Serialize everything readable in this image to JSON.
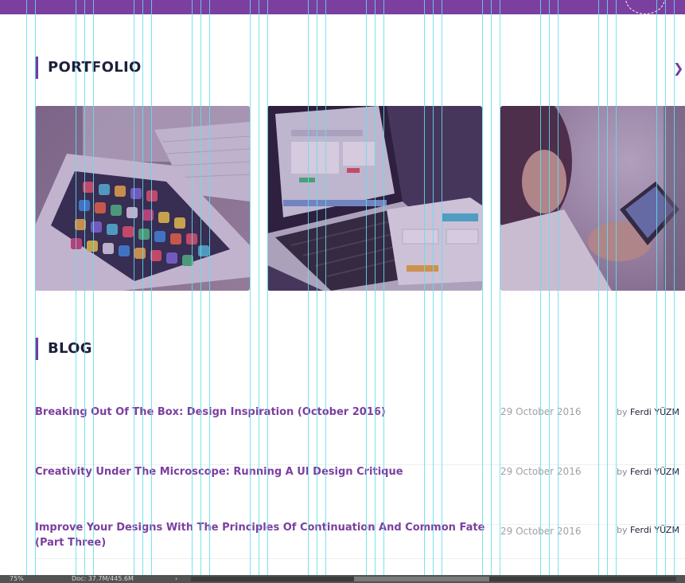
{
  "portfolio": {
    "title": "PORTFOLIO",
    "next_arrow": "❯",
    "items": [
      {
        "icon": "tablet-photo"
      },
      {
        "icon": "laptop-photo"
      },
      {
        "icon": "phone-photo"
      }
    ]
  },
  "blog": {
    "title": "BLOG",
    "by_label": "by",
    "posts": [
      {
        "title": "Breaking Out Of The Box: Design Inspiration (October 2016)",
        "date": "29 October 2016",
        "author": "Ferdi YÜZM"
      },
      {
        "title": "Creativity Under The Microscope: Running A UI Design Critique",
        "date": "29 October 2016",
        "author": "Ferdi YÜZM"
      },
      {
        "title": "Improve Your Designs With The Principles Of Continuation And Common Fate (Part Three)",
        "date": "29 October 2016",
        "author": "Ferdi YÜZM"
      }
    ]
  },
  "statusbar": {
    "zoom": "75%",
    "doc": "Doc: 37.7M/445.6M",
    "arrow": "›"
  },
  "colors": {
    "accent": "#7b3fa0",
    "heading": "#1e1f3b",
    "guide": "#5fe0ec"
  }
}
